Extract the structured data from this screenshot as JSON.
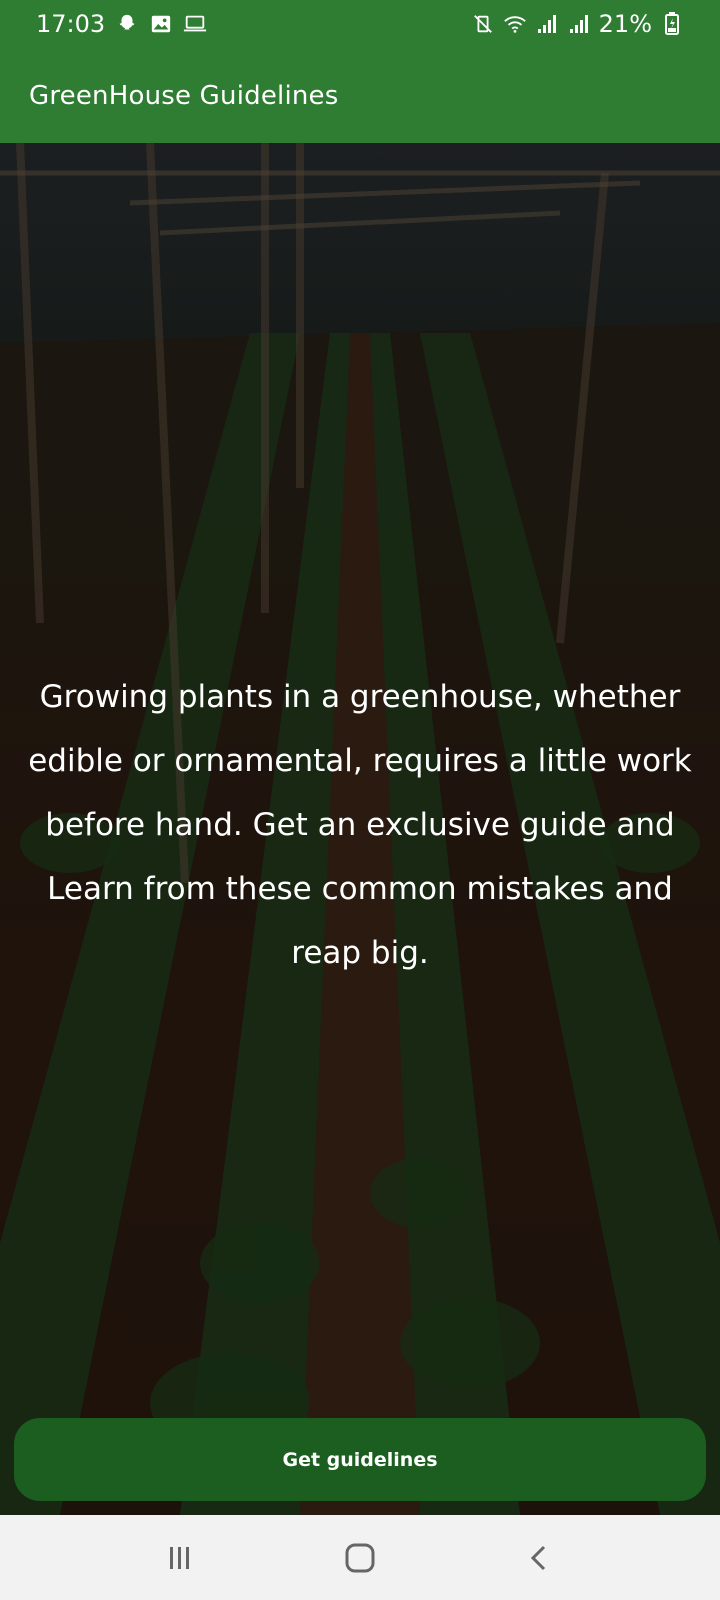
{
  "status_bar": {
    "time": "17:03",
    "left_icons": [
      "snapchat-icon",
      "image-icon",
      "laptop-icon"
    ],
    "right_icons": [
      "vibrate-mute-icon",
      "wifi-icon",
      "signal-icon",
      "signal-icon",
      "battery-charging-icon"
    ],
    "battery": "21%"
  },
  "app_bar": {
    "title": "GreenHouse Guidelines"
  },
  "hero": {
    "message": "Growing plants in a greenhouse, whether edible or ornamental, requires a little work before hand. Get an exclusive guide and Learn from these common mistakes and reap big."
  },
  "action": {
    "label": "Get guidelines"
  },
  "nav_bar": {
    "icons": [
      "recent-apps-icon",
      "home-icon",
      "back-icon"
    ]
  },
  "colors": {
    "app_bar": "#2e7d32",
    "button": "#1b5e20",
    "nav_bar": "#f2f2f2",
    "text": "#ffffff"
  }
}
